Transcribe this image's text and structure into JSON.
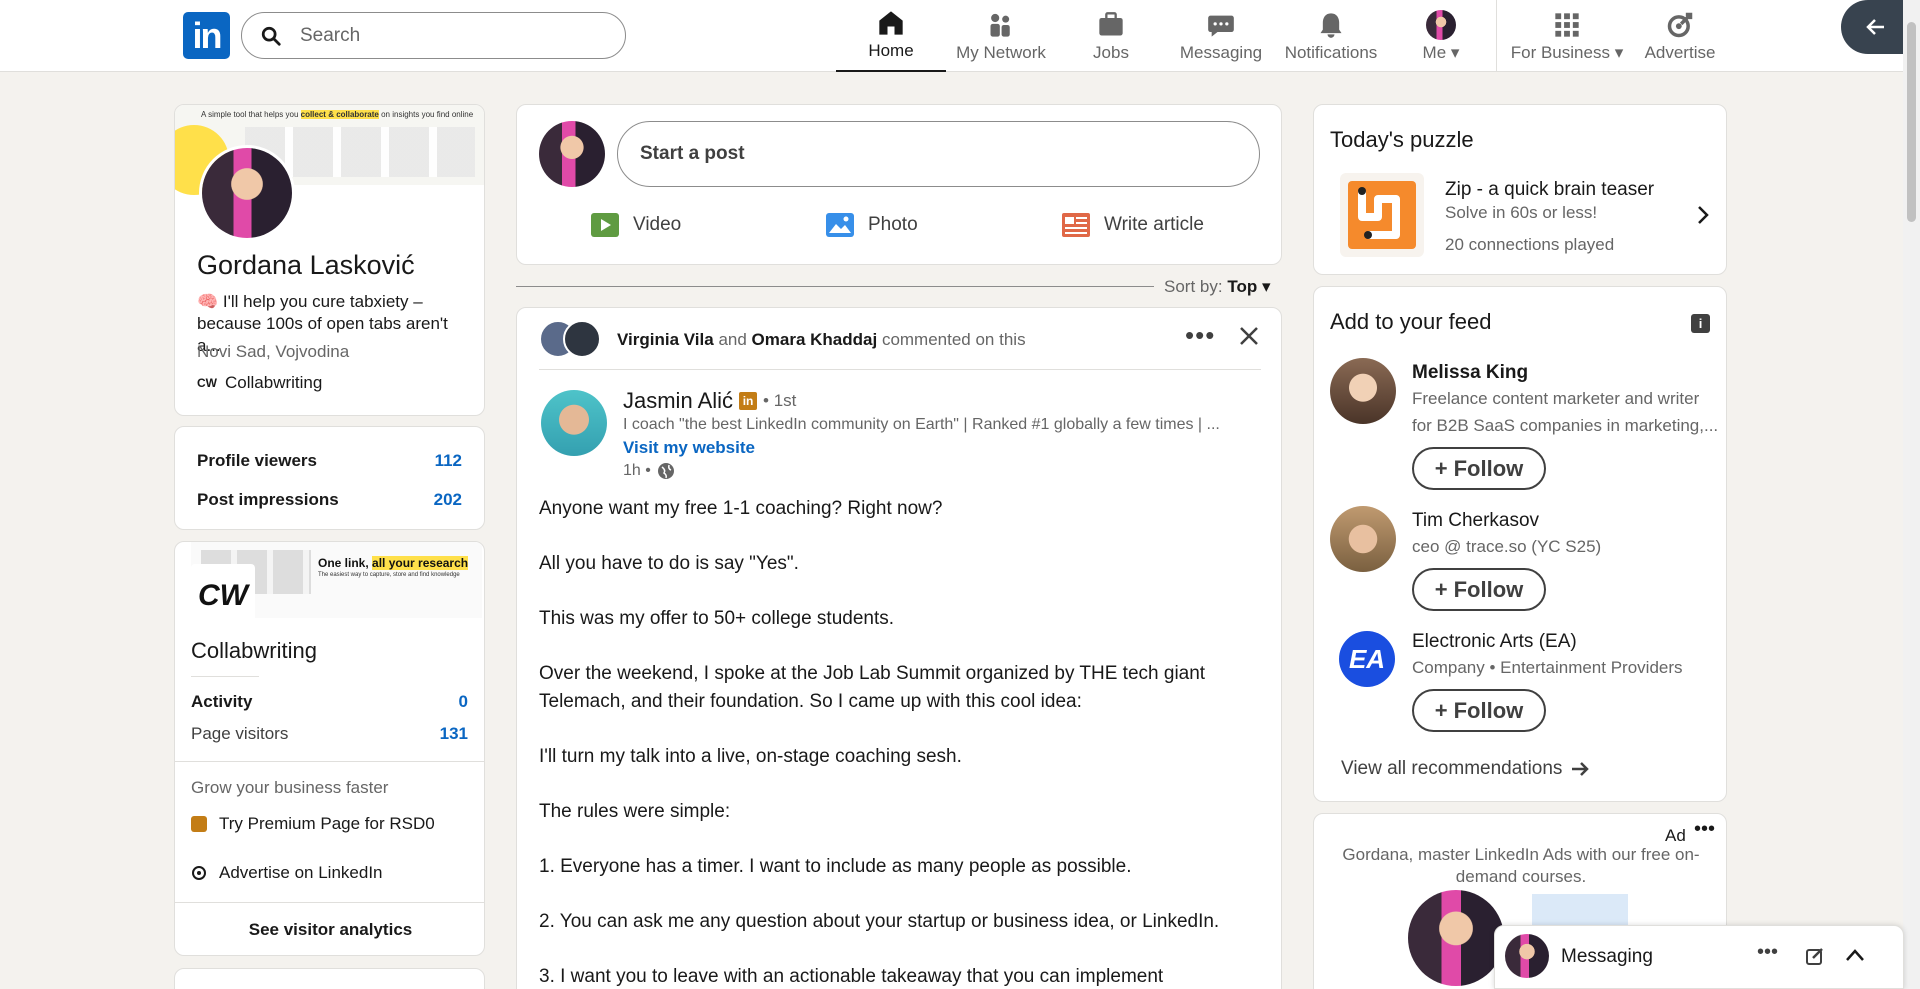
{
  "topbar": {
    "search_placeholder": "Search",
    "nav": {
      "home": "Home",
      "network": "My Network",
      "jobs": "Jobs",
      "messaging": "Messaging",
      "notifications": "Notifications",
      "me": "Me",
      "business": "For Business",
      "advertise": "Advertise"
    }
  },
  "profile": {
    "banner_tagline_a": "A simple tool that helps you",
    "banner_tagline_b": "collect & collaborate",
    "banner_tagline_c": "on insights you find online",
    "name": "Gordana Lasković",
    "headline": "🧠 I'll help you cure tabxiety – because 100s of open tabs aren't a...",
    "location": "Novi Sad, Vojvodina",
    "company": "Collabwriting"
  },
  "stats": {
    "viewers_label": "Profile viewers",
    "viewers_value": "112",
    "impressions_label": "Post impressions",
    "impressions_value": "202"
  },
  "page_card": {
    "banner_a": "One link,",
    "banner_b": "all your research",
    "banner_sub": "The easiest way to capture, store and find knowledge",
    "logo_text": "CW",
    "name": "Collabwriting",
    "activity_label": "Activity",
    "activity_value": "0",
    "visitors_label": "Page visitors",
    "visitors_value": "131",
    "grow": "Grow your business faster",
    "premium": "Try Premium Page for RSD0",
    "advertise": "Advertise on LinkedIn",
    "analytics": "See visitor analytics"
  },
  "composer": {
    "placeholder": "Start a post",
    "video": "Video",
    "photo": "Photo",
    "article": "Write article"
  },
  "sort": {
    "label": "Sort by:",
    "value": "Top"
  },
  "post": {
    "commenter_1": "Virginia Vila",
    "and": "and",
    "commenter_2": "Omara Khaddaj",
    "commented": "commented on this",
    "author": "Jasmin Alić",
    "degree": "• 1st",
    "author_headline": "I coach \"the best LinkedIn community on Earth\" | Ranked #1 globally a few times | ...",
    "website": "Visit my website",
    "time": "1h •",
    "paragraphs": [
      "Anyone want my free 1-1 coaching? Right now?",
      "All you have to do is say \"Yes\".",
      "This was my offer to 50+ college students.",
      "Over the weekend, I spoke at the Job Lab Summit organized by THE tech giant Telemach, and their foundation. So I came up with this cool idea:",
      "I'll turn my talk into a live, on-stage coaching sesh.",
      "The rules were simple:",
      "1. Everyone has a timer. I want to include as many people as possible.",
      "2. You can ask me any question about your startup or business idea, or LinkedIn.",
      "3. I want you to leave with an actionable takeaway that you can implement"
    ]
  },
  "puzzle": {
    "title": "Today's puzzle",
    "name": "Zip - a quick brain teaser",
    "desc": "Solve in 60s or less!",
    "played": "20 connections played"
  },
  "feed": {
    "title": "Add to your feed",
    "follow": "Follow",
    "people": [
      {
        "name": "Melissa King",
        "line1": "Freelance content marketer and writer",
        "line2": "for B2B SaaS companies in marketing,..."
      },
      {
        "name": "Tim Cherkasov",
        "line1": "ceo @ trace.so (YC S25)"
      },
      {
        "name": "Electronic Arts (EA)",
        "line1": "Company • Entertainment Providers",
        "logo": "EA"
      }
    ],
    "view_all": "View all recommendations"
  },
  "ad": {
    "label": "Ad",
    "text": "Gordana, master LinkedIn Ads with our free on-demand courses."
  },
  "messaging": {
    "label": "Messaging"
  },
  "colors": {
    "brand": "#0a66c2",
    "premium": "#c37d16"
  }
}
